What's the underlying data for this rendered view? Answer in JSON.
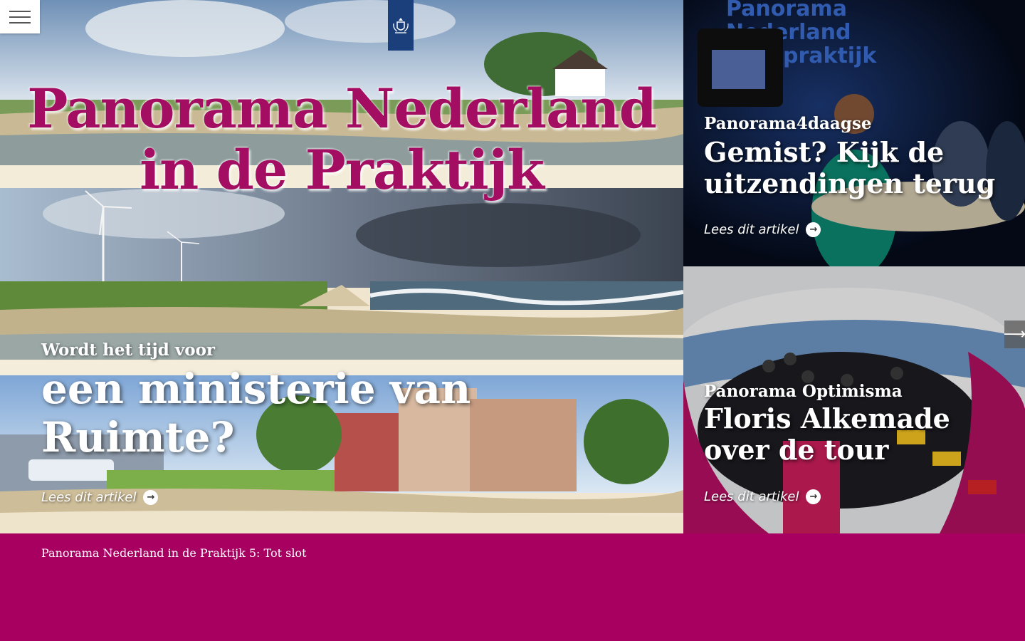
{
  "hero": {
    "title": "Panorama Nederland in de Praktijk",
    "kicker": "Wordt het tijd voor",
    "headline": "een ministerie van Ruimte?",
    "link_label": "Lees dit artikel"
  },
  "cards": [
    {
      "kicker": "Panorama4daagse",
      "title": "Gemist? Kijk de uitzendingen terug",
      "link_label": "Lees dit artikel"
    },
    {
      "kicker": "Panorama Optimisma",
      "title": "Floris Alkemade over de tour",
      "link_label": "Lees dit artikel"
    }
  ],
  "footer": {
    "link_text": "Panorama Nederland in de Praktijk 5: Tot slot"
  },
  "icons": {
    "menu": "hamburger-icon",
    "logo": "coat-of-arms-icon",
    "read_more": "arrow-right-circle-icon",
    "next": "arrow-right-icon"
  },
  "colors": {
    "brand_magenta": "#a80060",
    "title_magenta": "#a30d62",
    "logo_blue": "#1a3f7a"
  }
}
